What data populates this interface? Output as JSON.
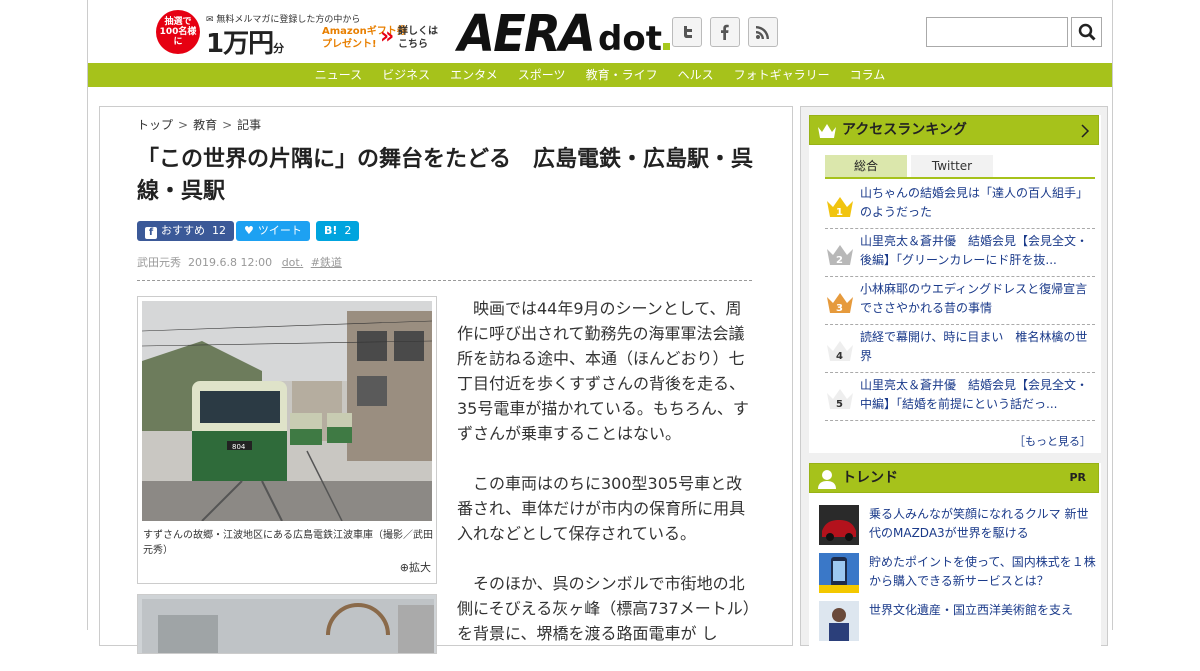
{
  "header": {
    "promo": {
      "badge": "抽選で100名様に",
      "mail": "無料メルマガに登録した方の中から",
      "amount": "1万円",
      "amount_unit": "分",
      "gift_line1": "Amazonギフト券",
      "gift_line2": "プレゼント!",
      "more_line1": "詳しくは",
      "more_line2": "こちら"
    },
    "logo_main": "AERA",
    "logo_sub": "dot"
  },
  "nav": [
    "ニュース",
    "ビジネス",
    "エンタメ",
    "スポーツ",
    "教育・ライフ",
    "ヘルス",
    "フォトギャラリー",
    "コラム"
  ],
  "breadcrumb": {
    "home": "トップ",
    "section": "教育",
    "current": "記事"
  },
  "article": {
    "title": "「この世界の片隅に」の舞台をたどる　広島電鉄・広島駅・呉線・呉駅",
    "share": {
      "fb_label": "おすすめ",
      "fb_count": "12",
      "tw_label": "ツイート",
      "hb_label": "B!",
      "hb_count": "2"
    },
    "author": "武田元秀",
    "date": "2019.6.8 12:00",
    "source": "dot.",
    "tag": "#鉄道",
    "photo_caption": "すずさんの故郷・江波地区にある広島電鉄江波車庫（撮影／武田元秀）",
    "photo_zoom": "拡大",
    "paragraphs": [
      "映画では44年9月のシーンとして、周作に呼び出されて勤務先の海軍軍法会議所を訪ねる途中、本通（ほんどおり）七丁目付近を歩くすずさんの背後を走る、35号電車が描かれている。もちろん、すずさんが乗車することはない。",
      "この車両はのちに300型305号車と改番され、車体だけが市内の保育所に用具入れなどとして保存されている。",
      "そのほか、呉のシンボルで市街地の北側にそびえる灰ヶ峰（標高737メートル）を背景に、堺橋を渡る路面電車が し"
    ]
  },
  "ranking": {
    "title": "アクセスランキング",
    "tabs": [
      "総合",
      "Twitter"
    ],
    "items": [
      {
        "rank": "1",
        "text": "山ちゃんの結婚会見は「達人の百人組手」のようだった"
      },
      {
        "rank": "2",
        "text": "山里亮太＆蒼井優　結婚会見【会見全文・後編】「グリーンカレーにド肝を抜..."
      },
      {
        "rank": "3",
        "text": "小林麻耶のウエディングドレスと復帰宣言でささやかれる昔の事情"
      },
      {
        "rank": "4",
        "text": "読経で幕開け、時に目まい　椎名林檎の世界"
      },
      {
        "rank": "5",
        "text": "山里亮太＆蒼井優　結婚会見【会見全文・中編】「結婚を前提にという話だっ..."
      }
    ],
    "more": "［もっと見る］"
  },
  "trend": {
    "title": "トレンド",
    "pr": "PR",
    "items": [
      {
        "text": "乗る人みんなが笑顔になれるクルマ 新世代のMAZDA3が世界を駆ける"
      },
      {
        "text": "貯めたポイントを使って、国内株式を１株から購入できる新サービスとは？"
      },
      {
        "text": "世界文化遺産・国立西洋美術館を支え"
      }
    ]
  },
  "colors": {
    "accent": "#a6c21b",
    "link": "#1a3a8a",
    "facebook": "#3b5998",
    "twitter": "#1da1f2",
    "hatena": "#00a4de"
  }
}
